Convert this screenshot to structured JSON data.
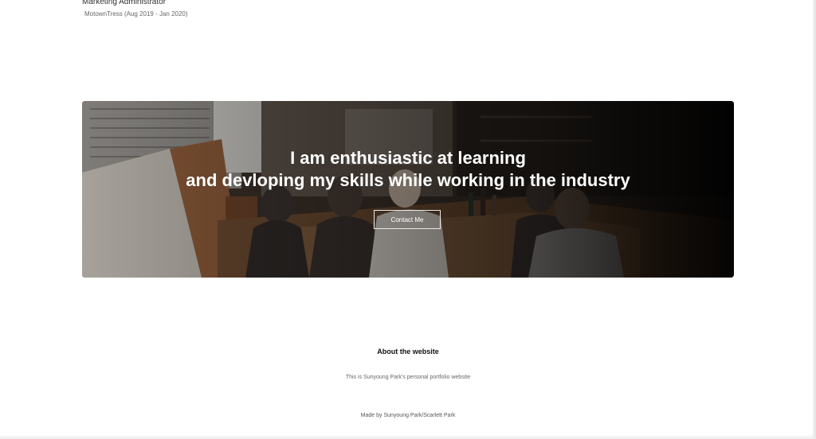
{
  "experience": {
    "title": "Marketing Administrator",
    "meta": "MotownTress (Aug 2019 - Jan 2020)"
  },
  "hero": {
    "line1": "I am enthusiastic at learning",
    "line2": "and devloping my skills while working in the industry",
    "cta_label": "Contact Me"
  },
  "footer": {
    "about_heading": "About the website",
    "about_text": "This is Sunyoung Park's personal portfolio website",
    "made_by": "Made by Sunyoung Park/Scarlett Park"
  },
  "colors": {
    "page_background": "#ffffff",
    "hero_text": "#ffffff",
    "heading_text": "#111111",
    "muted_text": "#666666"
  }
}
